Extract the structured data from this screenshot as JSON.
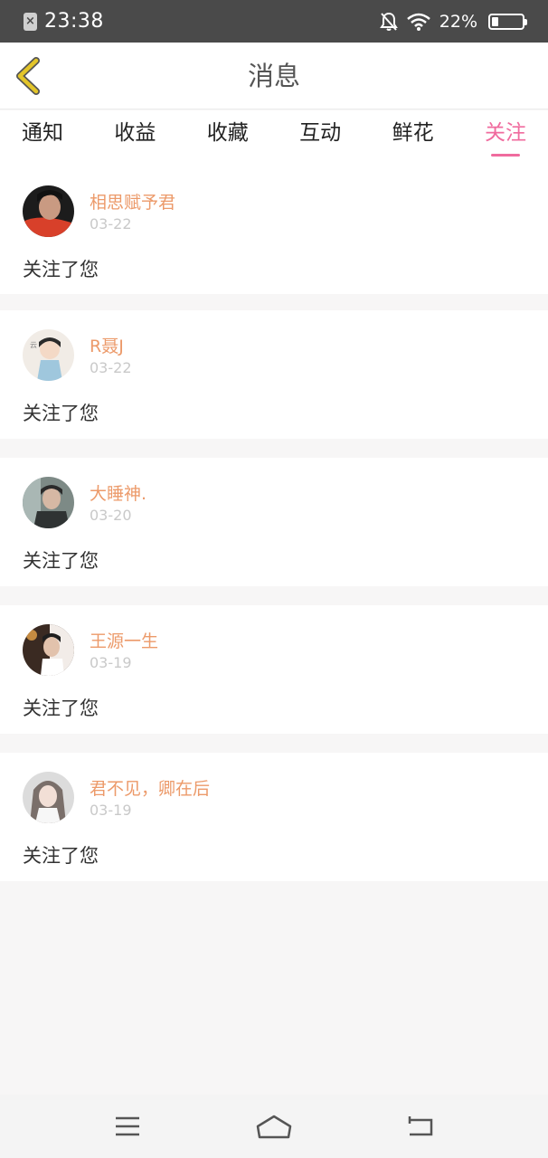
{
  "status_bar": {
    "time": "23:38",
    "battery": "22%",
    "battery_level": 0.22,
    "icons": [
      "sim-x-icon",
      "bell-off-icon",
      "wifi-icon",
      "battery-icon"
    ]
  },
  "header": {
    "title": "消息",
    "back_icon": "chevron-left-icon"
  },
  "tabs": [
    {
      "label": "通知",
      "active": false
    },
    {
      "label": "收益",
      "active": false
    },
    {
      "label": "收藏",
      "active": false
    },
    {
      "label": "互动",
      "active": false
    },
    {
      "label": "鲜花",
      "active": false
    },
    {
      "label": "关注",
      "active": true
    }
  ],
  "notifications": [
    {
      "username": "相思赋予君",
      "date": "03-22",
      "message": "关注了您"
    },
    {
      "username": "R聂J",
      "date": "03-22",
      "message": "关注了您"
    },
    {
      "username": "大睡神.",
      "date": "03-20",
      "message": "关注了您"
    },
    {
      "username": "王源一生",
      "date": "03-19",
      "message": "关注了您"
    },
    {
      "username": "君不见，卿在后",
      "date": "03-19",
      "message": "关注了您"
    }
  ],
  "bottom_nav": {
    "icons": [
      "menu-icon",
      "home-icon",
      "back-icon"
    ]
  },
  "colors": {
    "accent": "#f06b9e",
    "username": "#ec9a6a",
    "date": "#c9c9c9",
    "status_bar_bg": "#4a4a4a",
    "back_chevron": "#e3c52a"
  }
}
